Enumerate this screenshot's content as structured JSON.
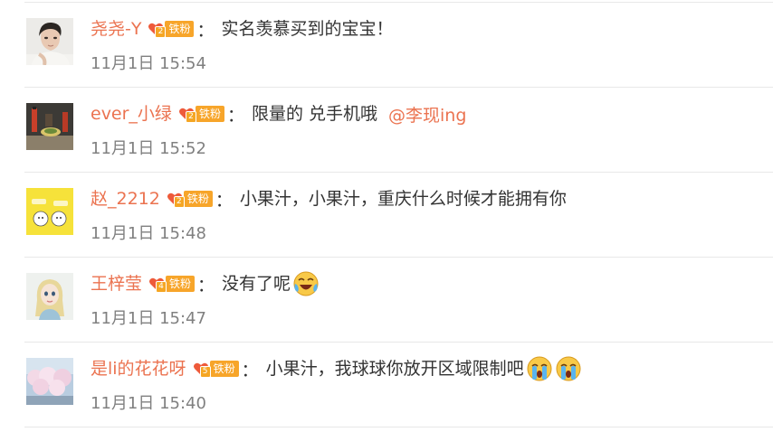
{
  "comments": [
    {
      "username": "尧尧-Y",
      "fan_level": "2",
      "fan_label": "铁粉",
      "colon": "：",
      "text": "实名羡慕买到的宝宝！",
      "mention": "",
      "emojis": [],
      "time": "11月1日 15:54",
      "avatar": "avatar-young-man-photo"
    },
    {
      "username": "ever_小绿",
      "fan_level": "2",
      "fan_label": "铁粉",
      "colon": "：",
      "text": "限量的 兑手机哦",
      "mention": "@李现ing",
      "emojis": [],
      "time": "11月1日 15:52",
      "avatar": "avatar-still-life-photo"
    },
    {
      "username": "赵_2212",
      "fan_level": "2",
      "fan_label": "铁粉",
      "colon": "：",
      "text": "小果汁，小果汁，重庆什么时候才能拥有你",
      "mention": "",
      "emojis": [],
      "time": "11月1日 15:48",
      "avatar": "avatar-yellow-cartoon"
    },
    {
      "username": "王梓莹",
      "fan_level": "4",
      "fan_label": "铁粉",
      "colon": "：",
      "text": "没有了呢",
      "mention": "",
      "emojis": [
        "laugh-cry-emoji"
      ],
      "time": "11月1日 15:47",
      "avatar": "avatar-cartoon-princess"
    },
    {
      "username": "是li的花花呀",
      "fan_level": "5",
      "fan_label": "铁粉",
      "colon": "：",
      "text": "小果汁，我球球你放开区域限制吧",
      "mention": "",
      "emojis": [
        "crying-emoji",
        "crying-emoji"
      ],
      "time": "11月1日 15:40",
      "avatar": "avatar-cherry-blossom-photo"
    }
  ],
  "colors": {
    "username": "#eb7350",
    "text": "#333333",
    "time": "#808080",
    "badge": "#f7a52a",
    "divider": "#e8e8e8"
  }
}
